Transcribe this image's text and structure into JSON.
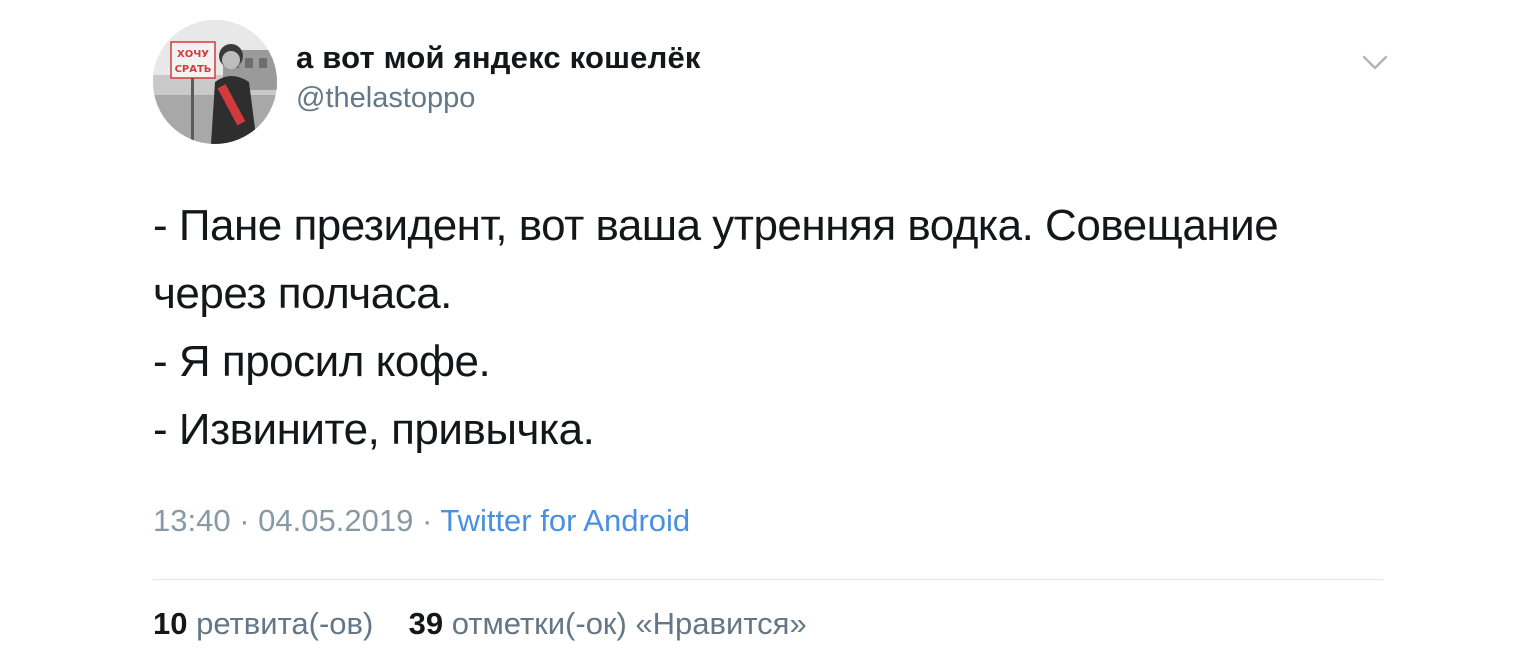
{
  "user": {
    "display_name": "а вот мой яндекс кошелёк",
    "handle": "@thelastoppo",
    "avatar_sign_text": "ХОЧУ СРАТЬ"
  },
  "menu": {
    "icon": "chevron-down-icon"
  },
  "tweet": {
    "lines": [
      "- Пане президент, вот ваша утренняя водка. Совещание",
      "через полчаса.",
      "- Я просил кофе.",
      "- Извините, привычка."
    ]
  },
  "meta": {
    "time": "13:40",
    "separator": "·",
    "date": "04.05.2019",
    "source": "Twitter for Android"
  },
  "stats": {
    "retweets_count": "10",
    "retweets_label": "ретвита(-ов)",
    "likes_count": "39",
    "likes_label": "отметки(-ок) «Нравится»"
  },
  "colors": {
    "text": "#14171a",
    "secondary": "#657786",
    "link": "#4a90e2",
    "divider": "#e1e8ed"
  }
}
